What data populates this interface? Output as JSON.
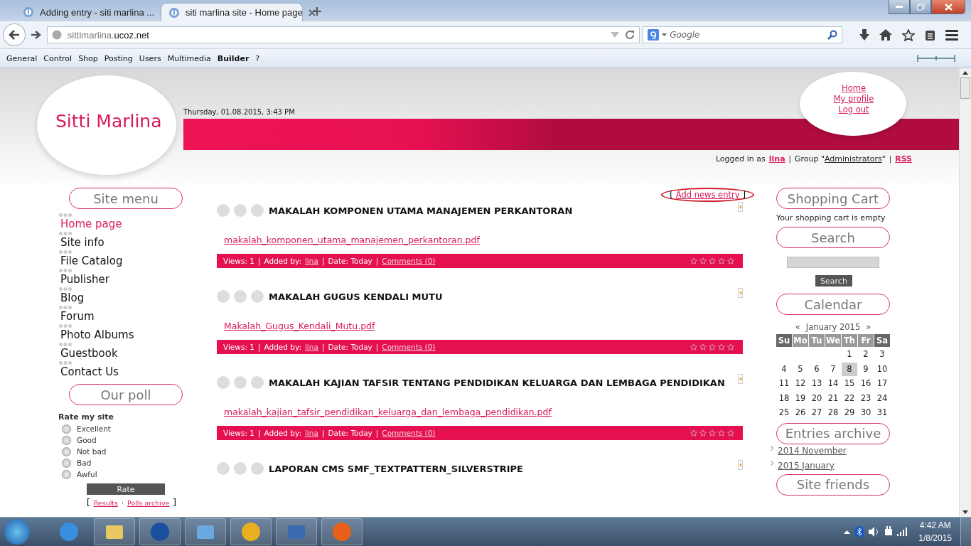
{
  "browser": {
    "tabs": [
      {
        "title": "Adding entry - siti marlina ...",
        "selected": false
      },
      {
        "title": "siti marlina site - Home page",
        "selected": true
      }
    ],
    "url": {
      "prefix": "sittimarlina.",
      "domain": "ucoz.net"
    },
    "search": {
      "placeholder": "Google"
    }
  },
  "admin_bar": [
    {
      "label": "General",
      "bold": false
    },
    {
      "label": "Control",
      "bold": false
    },
    {
      "label": "Shop",
      "bold": false
    },
    {
      "label": "Posting",
      "bold": false
    },
    {
      "label": "Users",
      "bold": false
    },
    {
      "label": "Multimedia",
      "bold": false
    },
    {
      "label": "Builder",
      "bold": true
    },
    {
      "label": "?",
      "bold": false
    }
  ],
  "header": {
    "site_title": "Sitti Marlina",
    "date": "Thursday, 01.08.2015, 3:43 PM",
    "user_links": [
      "Home",
      "My profile",
      "Log out"
    ],
    "login": [
      {
        "kind": "text",
        "text": "Logged in as"
      },
      {
        "kind": "link",
        "text": "lina"
      },
      {
        "kind": "sep",
        "text": "|"
      },
      {
        "kind": "text",
        "text": "Group \""
      },
      {
        "kind": "group",
        "text": "Administrators"
      },
      {
        "kind": "text",
        "text": "\""
      },
      {
        "kind": "sep",
        "text": "|"
      },
      {
        "kind": "link",
        "text": "RSS"
      }
    ]
  },
  "site_menu": {
    "heading": "Site menu",
    "items": [
      {
        "label": "Home page",
        "selected": true
      },
      {
        "label": "Site info",
        "selected": false
      },
      {
        "label": "File Catalog",
        "selected": false
      },
      {
        "label": "Publisher",
        "selected": false
      },
      {
        "label": "Blog",
        "selected": false
      },
      {
        "label": "Forum",
        "selected": false
      },
      {
        "label": "Photo Albums",
        "selected": false
      },
      {
        "label": "Guestbook",
        "selected": false
      },
      {
        "label": "Contact Us",
        "selected": false
      }
    ]
  },
  "poll": {
    "heading": "Our poll",
    "question": "Rate my site",
    "options": [
      {
        "label": "Excellent",
        "selected": false
      },
      {
        "label": "Good",
        "selected": false
      },
      {
        "label": "Not bad",
        "selected": false
      },
      {
        "label": "Bad",
        "selected": false
      },
      {
        "label": "Awful",
        "selected": false
      }
    ],
    "button": "Rate",
    "links": [
      {
        "kind": "bracket",
        "text": "["
      },
      {
        "kind": "link",
        "text": "Results"
      },
      {
        "kind": "dot",
        "text": "·"
      },
      {
        "kind": "link",
        "text": "Polls archive"
      },
      {
        "kind": "bracket",
        "text": "]"
      }
    ]
  },
  "add_entry": {
    "open": "[",
    "link": "Add news entry",
    "close": "]",
    "circled": true
  },
  "entries": [
    {
      "title": "MAKALAH KOMPONEN UTAMA MANAJEMEN PERKANTORAN",
      "file": "makalah_komponen_utama_manajemen_perkantoran.pdf",
      "stars": 0,
      "meta": [
        {
          "kind": "text",
          "text": "Views: 1"
        },
        {
          "kind": "sep",
          "text": "|"
        },
        {
          "kind": "text",
          "text": "Added by:"
        },
        {
          "kind": "link",
          "text": "lina"
        },
        {
          "kind": "sep",
          "text": "|"
        },
        {
          "kind": "text",
          "text": "Date: Today"
        },
        {
          "kind": "sep",
          "text": "|"
        },
        {
          "kind": "link",
          "text": "Comments (0)"
        }
      ]
    },
    {
      "title": "MAKALAH GUGUS KENDALI MUTU",
      "file": "Makalah_Gugus_Kendali_Mutu.pdf",
      "stars": 0,
      "meta": [
        {
          "kind": "text",
          "text": "Views: 1"
        },
        {
          "kind": "sep",
          "text": "|"
        },
        {
          "kind": "text",
          "text": "Added by:"
        },
        {
          "kind": "link",
          "text": "lina"
        },
        {
          "kind": "sep",
          "text": "|"
        },
        {
          "kind": "text",
          "text": "Date: Today"
        },
        {
          "kind": "sep",
          "text": "|"
        },
        {
          "kind": "link",
          "text": "Comments (0)"
        }
      ]
    },
    {
      "title": "MAKALAH KAJIAN TAFSIR TENTANG PENDIDIKAN KELUARGA DAN LEMBAGA PENDIDIKAN",
      "file": "makalah_kajian_tafsir_pendidikan_keluarga_dan_lembaga_pendidikan.pdf",
      "stars": 0,
      "meta": [
        {
          "kind": "text",
          "text": "Views: 1"
        },
        {
          "kind": "sep",
          "text": "|"
        },
        {
          "kind": "text",
          "text": "Added by:"
        },
        {
          "kind": "link",
          "text": "lina"
        },
        {
          "kind": "sep",
          "text": "|"
        },
        {
          "kind": "text",
          "text": "Date: Today"
        },
        {
          "kind": "sep",
          "text": "|"
        },
        {
          "kind": "link",
          "text": "Comments (0)"
        }
      ]
    },
    {
      "title": "LAPORAN CMS SMF_TEXTPATTERN_SILVERSTRIPE"
    }
  ],
  "shopping_cart": {
    "heading": "Shopping Cart",
    "text": "Your shopping cart is empty"
  },
  "search_box": {
    "heading": "Search",
    "button": "Search"
  },
  "calendar": {
    "heading": "Calendar",
    "prev": "«",
    "month": "January 2015",
    "next": "»",
    "weekdays": [
      {
        "label": "Su",
        "weekend": true
      },
      {
        "label": "Mo",
        "weekend": false
      },
      {
        "label": "Tu",
        "weekend": false
      },
      {
        "label": "We",
        "weekend": false
      },
      {
        "label": "Th",
        "weekend": false
      },
      {
        "label": "Fr",
        "weekend": false
      },
      {
        "label": "Sa",
        "weekend": true
      }
    ],
    "weeks": [
      [
        {
          "day": "1",
          "selected": false
        },
        {
          "day": "2",
          "selected": false
        },
        {
          "day": "3",
          "selected": false
        }
      ],
      [
        {
          "day": "4",
          "selected": false
        },
        {
          "day": "5",
          "selected": false
        },
        {
          "day": "6",
          "selected": false
        },
        {
          "day": "7",
          "selected": false
        },
        {
          "day": "8",
          "selected": true
        },
        {
          "day": "9",
          "selected": false
        },
        {
          "day": "10",
          "selected": false
        }
      ],
      [
        {
          "day": "11",
          "selected": false
        },
        {
          "day": "12",
          "selected": false
        },
        {
          "day": "13",
          "selected": false
        },
        {
          "day": "14",
          "selected": false
        },
        {
          "day": "15",
          "selected": false
        },
        {
          "day": "16",
          "selected": false
        },
        {
          "day": "17",
          "selected": false
        }
      ],
      [
        {
          "day": "18",
          "selected": false
        },
        {
          "day": "19",
          "selected": false
        },
        {
          "day": "20",
          "selected": false
        },
        {
          "day": "21",
          "selected": false
        },
        {
          "day": "22",
          "selected": false
        },
        {
          "day": "23",
          "selected": false
        },
        {
          "day": "24",
          "selected": false
        }
      ],
      [
        {
          "day": "25",
          "selected": false
        },
        {
          "day": "26",
          "selected": false
        },
        {
          "day": "27",
          "selected": false
        },
        {
          "day": "28",
          "selected": false
        },
        {
          "day": "29",
          "selected": false
        },
        {
          "day": "30",
          "selected": false
        },
        {
          "day": "31",
          "selected": false
        }
      ]
    ]
  },
  "archive": {
    "heading": "Entries archive",
    "items": [
      "2014 November",
      "2015 January"
    ]
  },
  "site_friends": {
    "heading": "Site friends"
  },
  "taskbar": {
    "time": "4:42 AM",
    "date": "1/8/2015"
  }
}
